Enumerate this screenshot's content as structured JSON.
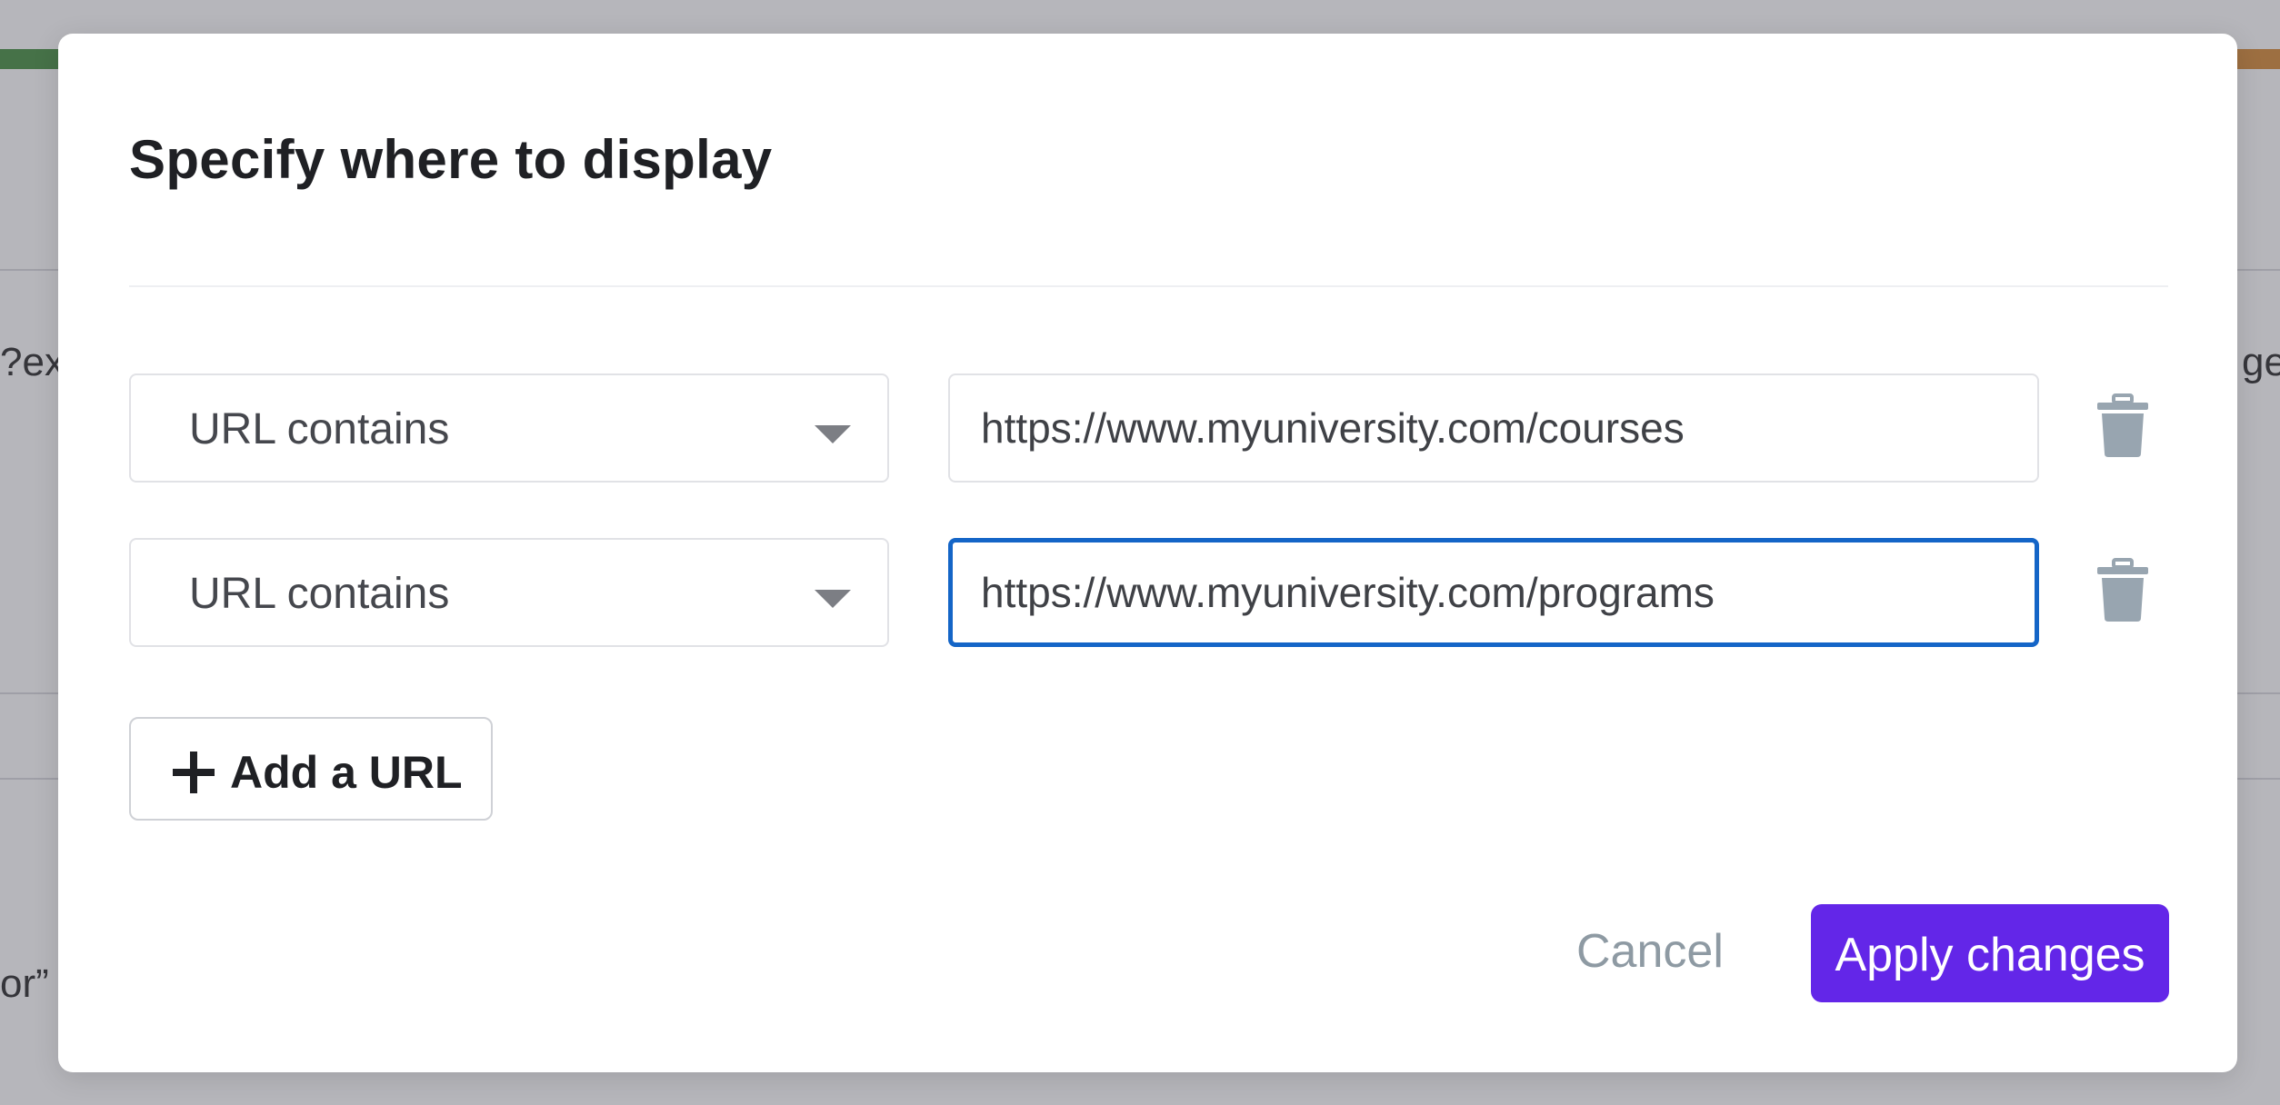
{
  "background": {
    "left_fragment_top": "?ex",
    "left_fragment_bottom": "or”",
    "right_fragment": "ge"
  },
  "modal": {
    "title": "Specify where to display",
    "rules": [
      {
        "condition": "URL contains",
        "url": "https://www.myuniversity.com/courses",
        "focused": false
      },
      {
        "condition": "URL contains",
        "url": "https://www.myuniversity.com/programs",
        "focused": true
      }
    ],
    "add_url_label": "Add a URL",
    "cancel_label": "Cancel",
    "apply_label": "Apply changes"
  },
  "colors": {
    "accent": "#6326e8",
    "focus": "#1465c7",
    "icon": "#98a5b0"
  },
  "icons": {
    "dropdown": "chevron-down-icon",
    "delete": "trash-icon",
    "add": "plus-icon"
  }
}
